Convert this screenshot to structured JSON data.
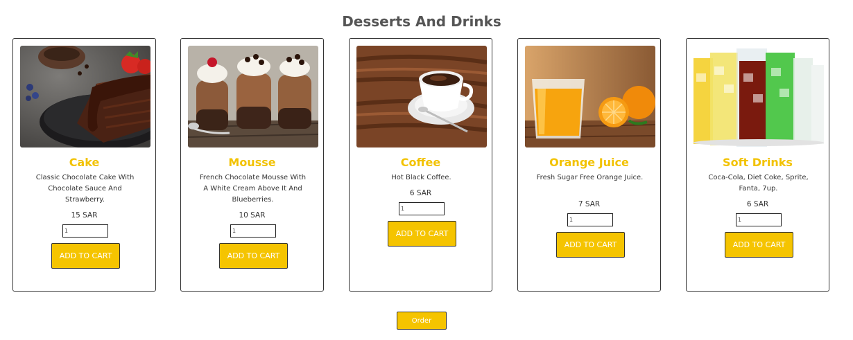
{
  "section": {
    "title": "Desserts And Drinks"
  },
  "products": [
    {
      "name": "Cake",
      "description": "Classic Chocolate Cake With Chocolate Sauce And Strawberry.",
      "price": "15 SAR",
      "quantity": "1",
      "button_label": "ADD TO CART",
      "image": "chocolate-cake-photo"
    },
    {
      "name": "Mousse",
      "description": "French Chocolate Mousse With A White Cream Above It And Blueberries.",
      "price": "10 SAR",
      "quantity": "1",
      "button_label": "ADD TO CART",
      "image": "chocolate-mousse-photo"
    },
    {
      "name": "Coffee",
      "description": "Hot Black Coffee.",
      "price": "6 SAR",
      "quantity": "1",
      "button_label": "ADD TO CART",
      "image": "coffee-cup-photo"
    },
    {
      "name": "Orange Juice",
      "description": "Fresh Sugar Free Orange Juice.",
      "price": "7 SAR",
      "quantity": "1",
      "button_label": "ADD TO CART",
      "image": "orange-juice-photo"
    },
    {
      "name": "Soft Drinks",
      "description": "Coca-Cola, Diet Coke, Sprite, Fanta, 7up.",
      "price": "6 SAR",
      "quantity": "1",
      "button_label": "ADD TO CART",
      "image": "soft-drinks-photo"
    }
  ],
  "order": {
    "label": "Order"
  },
  "colors": {
    "accent": "#f5c400",
    "title": "#f2c200",
    "heading": "#555555"
  }
}
